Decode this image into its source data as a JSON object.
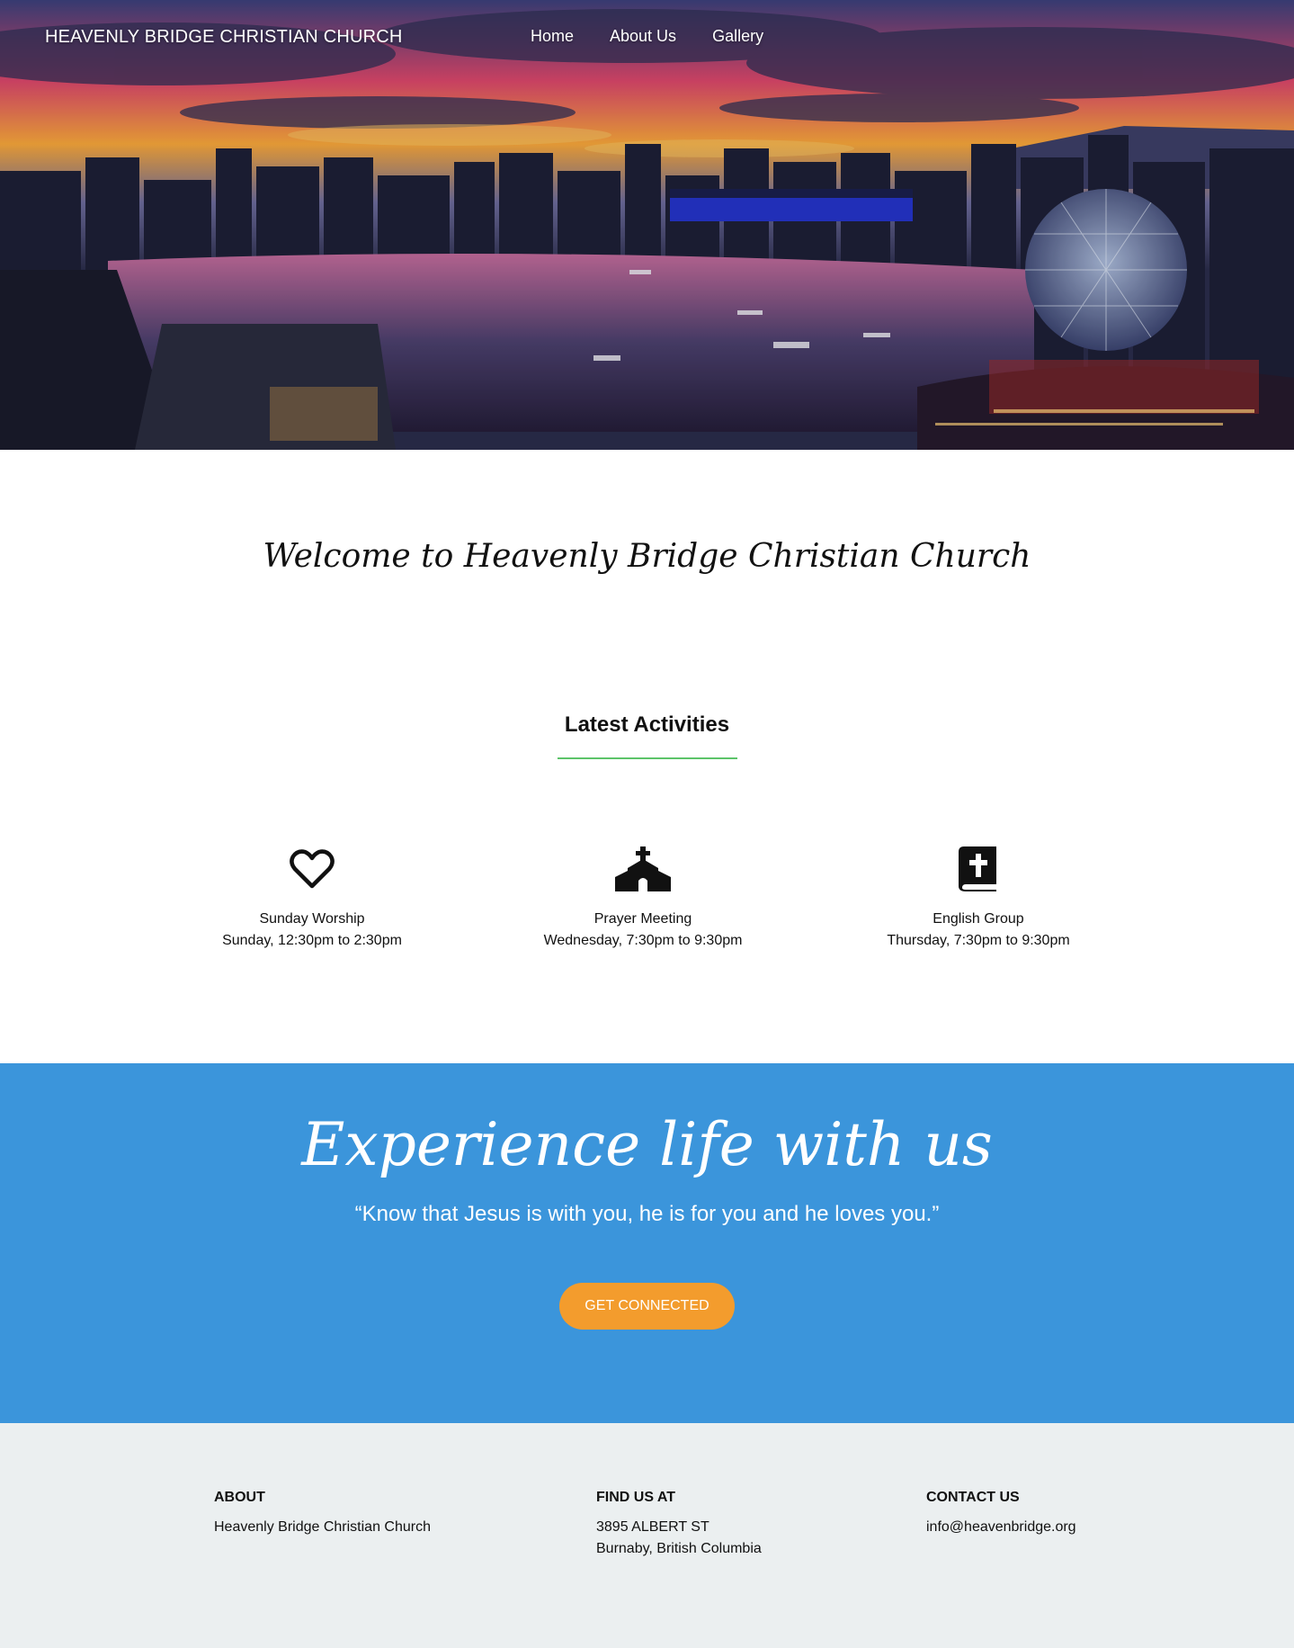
{
  "header": {
    "brand": "HEAVENLY BRIDGE CHRISTIAN CHURCH",
    "nav": [
      {
        "label": "Home"
      },
      {
        "label": "About Us"
      },
      {
        "label": "Gallery"
      }
    ]
  },
  "welcome": {
    "title": "Welcome to Heavenly Bridge Christian Church"
  },
  "activities": {
    "title": "Latest Activities",
    "accent_color": "#5cc46a",
    "items": [
      {
        "icon": "heart-icon",
        "name": "Sunday Worship",
        "time": "Sunday, 12:30pm to 2:30pm"
      },
      {
        "icon": "church-icon",
        "name": "Prayer Meeting",
        "time": "Wednesday, 7:30pm to 9:30pm"
      },
      {
        "icon": "bible-icon",
        "name": "English Group",
        "time": "Thursday, 7:30pm to 9:30pm"
      }
    ]
  },
  "cta": {
    "title": "Experience life with us",
    "quote": "“Know that Jesus is with you, he is for you and he loves you.”",
    "button_label": "GET CONNECTED",
    "bg_color": "#3b95db",
    "button_color": "#f39c2d"
  },
  "footer": {
    "about": {
      "heading": "ABOUT",
      "lines": [
        "Heavenly Bridge Christian Church"
      ]
    },
    "find": {
      "heading": "FIND US AT",
      "lines": [
        "3895 ALBERT ST",
        "Burnaby, British Columbia"
      ]
    },
    "contact": {
      "heading": "CONTACT US",
      "lines": [
        "info@heavenbridge.org"
      ]
    }
  }
}
